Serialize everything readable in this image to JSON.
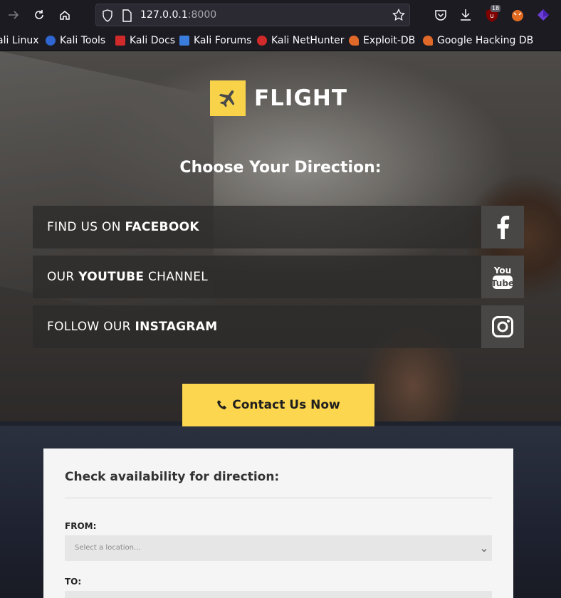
{
  "browser": {
    "url_host": "127.0.0.1",
    "url_port": ":8000",
    "extension_badge": "18"
  },
  "bookmarks": [
    {
      "label": "ali Linux",
      "icon": "kali-icon",
      "color": "#3b7ddd"
    },
    {
      "label": "Kali Tools",
      "icon": "kali-tools-icon",
      "color": "#2f66d0"
    },
    {
      "label": "Kali Docs",
      "icon": "kali-docs-icon",
      "color": "#d12a2a"
    },
    {
      "label": "Kali Forums",
      "icon": "kali-forums-icon",
      "color": "#3b7ddd"
    },
    {
      "label": "Kali NetHunter",
      "icon": "nethunter-icon",
      "color": "#d12a2a"
    },
    {
      "label": "Exploit-DB",
      "icon": "exploit-db-icon",
      "color": "#e0692a"
    },
    {
      "label": "Google Hacking DB",
      "icon": "ghdb-icon",
      "color": "#e0692a"
    }
  ],
  "page": {
    "logo_text": "FLIGHT",
    "heading": "Choose Your Direction:",
    "social": [
      {
        "prefix": "FIND US ON ",
        "bold": "FACEBOOK",
        "suffix": "",
        "icon": "facebook-icon"
      },
      {
        "prefix": "OUR ",
        "bold": "YOUTUBE",
        "suffix": " CHANNEL",
        "icon": "youtube-icon"
      },
      {
        "prefix": "FOLLOW OUR ",
        "bold": "INSTAGRAM",
        "suffix": "",
        "icon": "instagram-icon"
      }
    ],
    "contact_label": "Contact Us Now",
    "form": {
      "title": "Check availability for direction:",
      "from_label": "FROM:",
      "from_placeholder": "Select a location...",
      "to_label": "TO:"
    }
  },
  "colors": {
    "accent": "#fcd64e",
    "logo_box": "#f8d34a",
    "panel": "#f5f5f5"
  }
}
